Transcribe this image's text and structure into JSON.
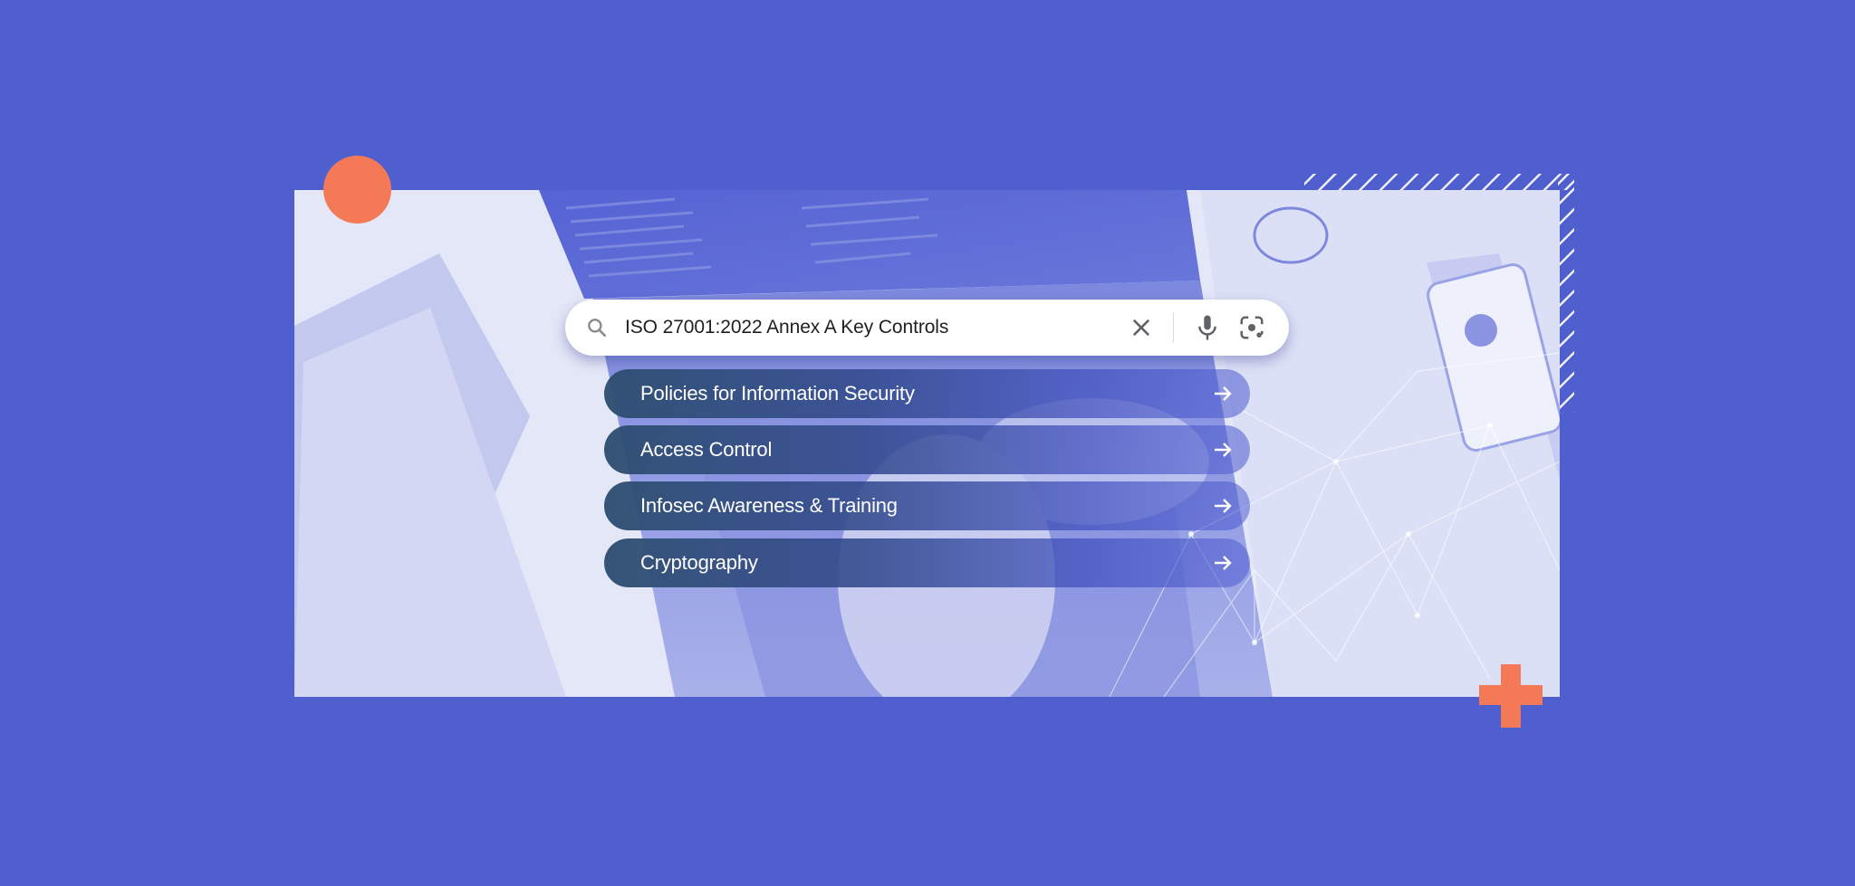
{
  "search": {
    "query": "ISO 27001:2022 Annex A Key Controls",
    "icons": {
      "search": "search-icon",
      "clear": "close-icon",
      "voice": "microphone-icon",
      "image_search": "lens-icon"
    }
  },
  "suggestions": [
    {
      "label": "Policies for Information Security",
      "icon": "arrow-right-icon"
    },
    {
      "label": "Access Control",
      "icon": "arrow-right-icon"
    },
    {
      "label": "Infosec Awareness & Training",
      "icon": "arrow-right-icon"
    },
    {
      "label": "Cryptography",
      "icon": "arrow-right-icon"
    }
  ],
  "colors": {
    "background": "#505FCE",
    "accent": "#F47A57",
    "pill": "#2E4E70",
    "search_bg": "#FFFFFF"
  }
}
